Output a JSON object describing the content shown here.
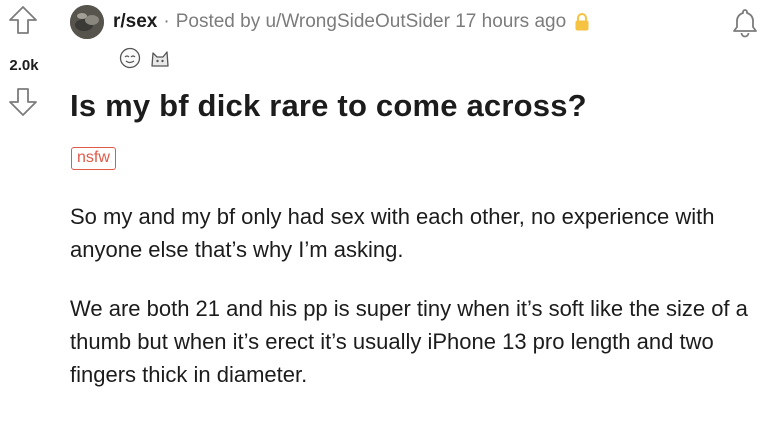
{
  "vote": {
    "score": "2.0k"
  },
  "header": {
    "subreddit": "r/sex",
    "separator": "·",
    "posted_text": "Posted by u/WrongSideOutSider 17 hours ago"
  },
  "icons": {
    "upvote": "arrow-up-outline-icon",
    "downvote": "arrow-down-outline-icon",
    "lock": "lock-icon",
    "bell": "bell-icon",
    "award_1": "award-face-icon",
    "award_2": "award-cat-icon"
  },
  "post": {
    "title": "Is my bf dick rare to come across?",
    "tag": "nsfw",
    "paragraphs": [
      "So my and my bf only had sex with each other, no experience with anyone else that’s why I’m asking.",
      "We are both 21 and his pp is super tiny when it’s soft like the size of a thumb but when it’s erect it’s usually iPhone 13 pro length and two fingers thick in diameter."
    ]
  },
  "colors": {
    "text": "#1c1c1c",
    "meta": "#7c7c7c",
    "nsfw": "#e05a49",
    "lock": "#f5c242"
  }
}
